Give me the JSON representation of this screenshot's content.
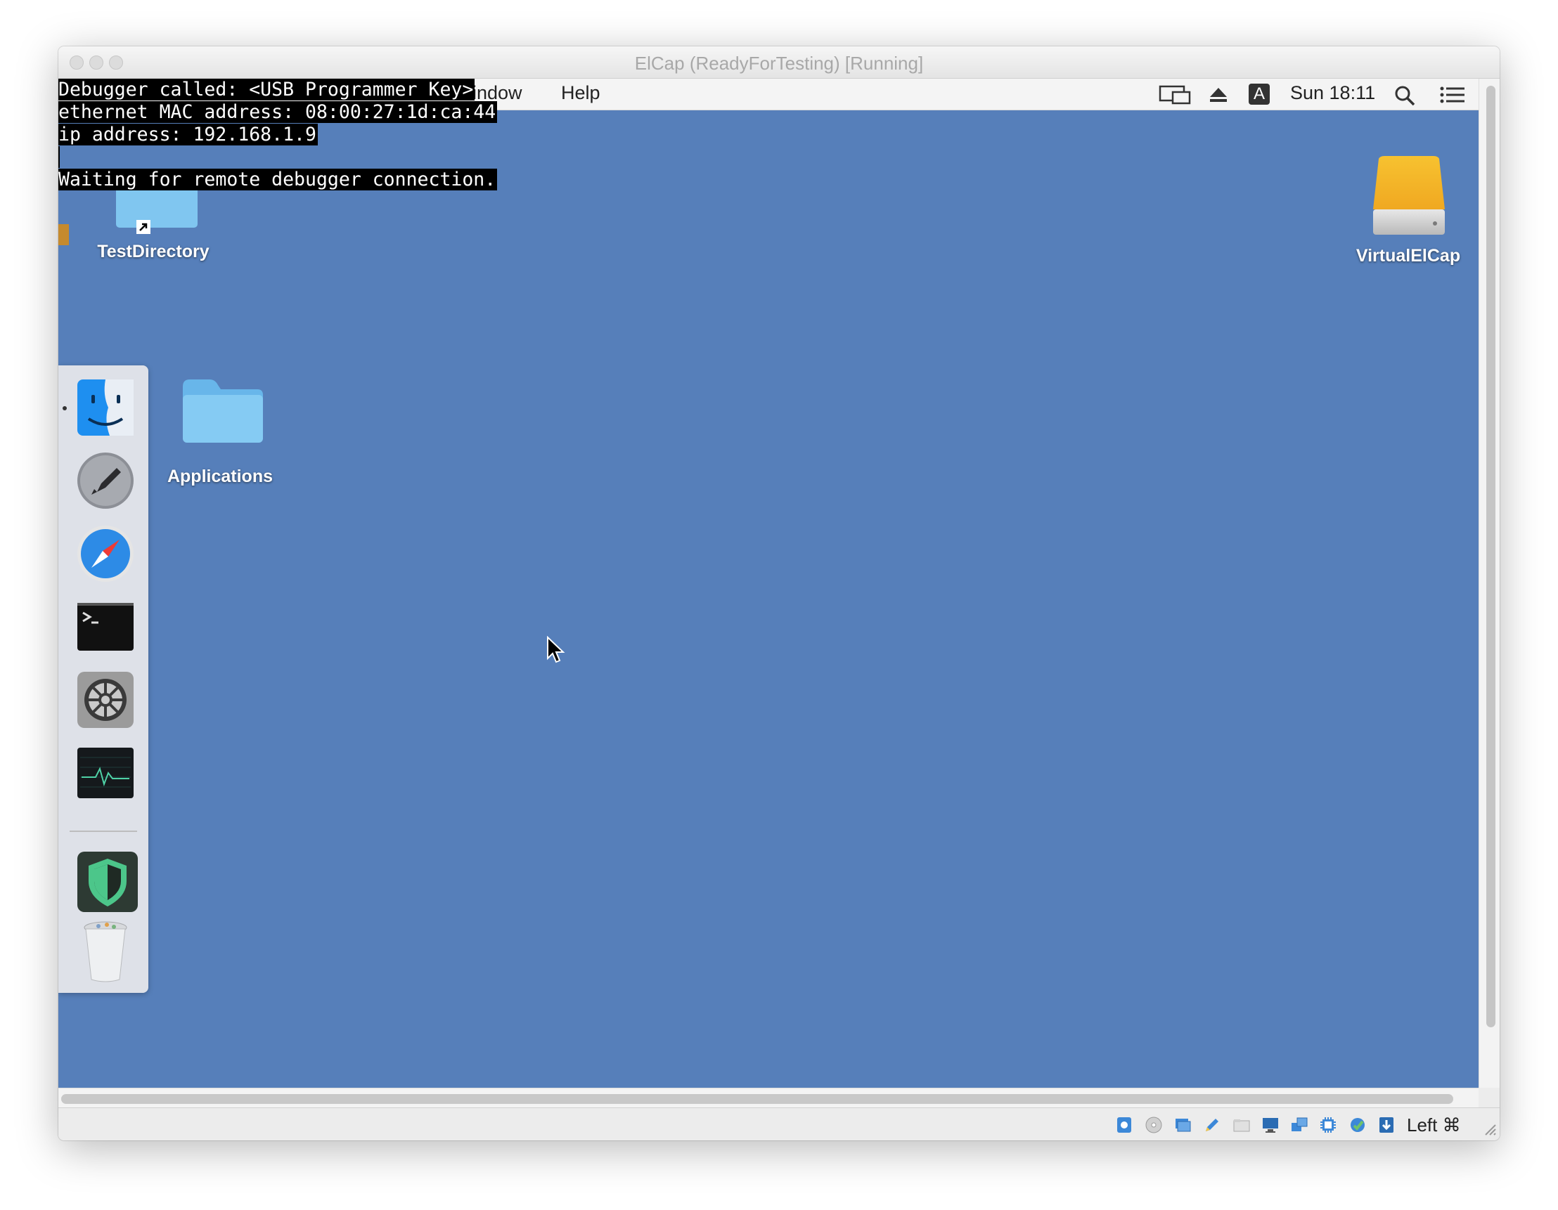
{
  "window": {
    "title": "ElCap (ReadyForTesting) [Running]"
  },
  "menubar": {
    "items": [
      "Window",
      "Help"
    ],
    "visible_window_fragment": "indow",
    "clock": "Sun 18:11",
    "input_source": "A",
    "icons": [
      "display-mirroring-icon",
      "eject-icon",
      "input-source-icon",
      "spotlight-search-icon",
      "notification-center-icon"
    ]
  },
  "console": {
    "lines": [
      "Debugger called: <USB Programmer Key>",
      "ethernet MAC address: 08:00:27:1d:ca:44",
      "ip address: 192.168.1.9",
      "",
      "Waiting for remote debugger connection."
    ],
    "colors": {
      "text": "#ffffff",
      "background": "#000000",
      "cursor": "#c58a2e"
    }
  },
  "desktop": {
    "background_color": "#567fba",
    "icons": [
      {
        "label": "TestDirectory",
        "type": "folder-alias"
      },
      {
        "label": "Applications",
        "type": "folder"
      },
      {
        "label": "VirtualElCap",
        "type": "external-drive"
      }
    ]
  },
  "dock": {
    "apps": [
      "Finder",
      "Launchpad",
      "Safari",
      "Terminal",
      "System Preferences",
      "Activity Monitor",
      "Security",
      "Trash"
    ]
  },
  "statusbar": {
    "host_key": "Left ⌘",
    "icons": [
      "hard-disk-icon",
      "optical-disk-icon",
      "audio-icon",
      "pencil-usb-icon",
      "shared-folder-icon",
      "display-icon",
      "network-icon",
      "cpu-icon",
      "capture-icon",
      "host-key-arrow-icon"
    ]
  }
}
